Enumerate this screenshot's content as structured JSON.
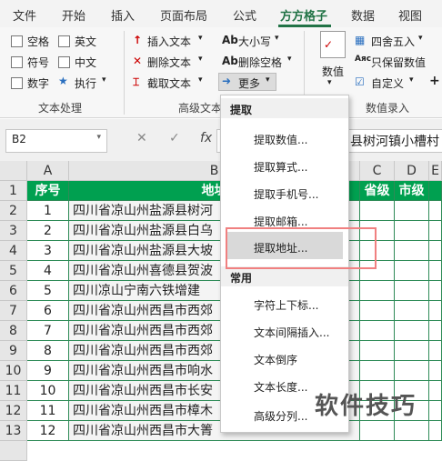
{
  "tabs": [
    "文件",
    "开始",
    "插入",
    "页面布局",
    "公式",
    "方方格子",
    "数据",
    "视图"
  ],
  "ribbon": {
    "checkboxes": [
      "空格",
      "英文",
      "符号",
      "中文",
      "数字",
      "执行"
    ],
    "group_text": "文本处理",
    "mid_items": [
      "插入文本",
      "删除文本",
      "截取文本"
    ],
    "mid_items2": [
      "大小写",
      "删除空格",
      "更多"
    ],
    "mid_icon_ab": "Ab",
    "group_advanced": "高级文本",
    "numval_label": "数值",
    "right_items": [
      "四舍五入",
      "只保留数值",
      "自定义"
    ],
    "group_entry": "数值录入",
    "plus": "+"
  },
  "formula": {
    "namebox": "B2",
    "fx": "fx",
    "cancel": "✕",
    "confirm": "✓",
    "content": "县树河镇小槽村"
  },
  "grid": {
    "col_headers": [
      "A",
      "B",
      "C",
      "D",
      "E"
    ],
    "header_row": [
      "序号",
      "地址",
      "省级",
      "市级"
    ],
    "rows": [
      {
        "n": "1",
        "addr": "四川省凉山州盐源县树河"
      },
      {
        "n": "2",
        "addr": "四川省凉山州盐源县白乌"
      },
      {
        "n": "3",
        "addr": "四川省凉山州盐源县大坡"
      },
      {
        "n": "4",
        "addr": "四川省凉山州喜德县贺波"
      },
      {
        "n": "5",
        "addr": "四川凉山宁南六铁增建"
      },
      {
        "n": "6",
        "addr": "四川省凉山州西昌市西郊"
      },
      {
        "n": "7",
        "addr": "四川省凉山州西昌市西郊"
      },
      {
        "n": "8",
        "addr": "四川省凉山州西昌市西郊"
      },
      {
        "n": "9",
        "addr": "四川省凉山州西昌市响水"
      },
      {
        "n": "10",
        "addr": "四川省凉山州西昌市长安"
      },
      {
        "n": "11",
        "addr": "四川省凉山州西昌市樟木"
      },
      {
        "n": "12",
        "addr": "四川省凉山州西昌市大箐"
      }
    ],
    "row_numbers": [
      "1",
      "2",
      "3",
      "4",
      "5",
      "6",
      "7",
      "8",
      "9",
      "10",
      "11",
      "12",
      "13"
    ]
  },
  "menu": {
    "section1": "提取",
    "items1": [
      "提取数值...",
      "提取算式...",
      "提取手机号...",
      "提取邮箱...",
      "提取地址..."
    ],
    "section2": "常用",
    "items2": [
      "字符上下标...",
      "文本间隔插入...",
      "文本倒序",
      "文本长度...",
      "高级分列..."
    ]
  },
  "watermark": "软件技巧"
}
